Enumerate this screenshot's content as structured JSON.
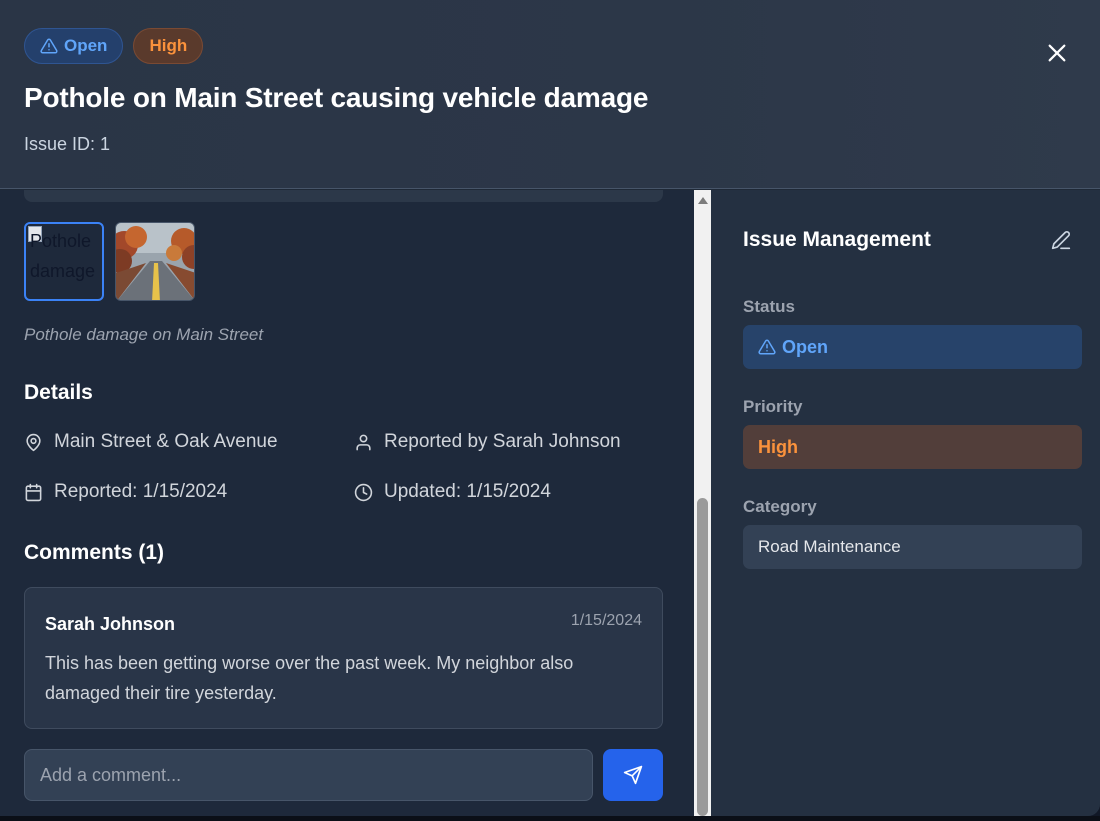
{
  "header": {
    "status_badge": "Open",
    "priority_badge": "High",
    "title": "Pothole on Main Street causing vehicle damage",
    "issue_id": "Issue ID: 1"
  },
  "media": {
    "broken_image_alt": "Pothole damage",
    "caption": "Pothole damage on Main Street"
  },
  "details": {
    "heading": "Details",
    "location": "Main Street & Oak Avenue",
    "reporter": "Reported by Sarah Johnson",
    "reported": "Reported: 1/15/2024",
    "updated": "Updated: 1/15/2024"
  },
  "comments": {
    "heading": "Comments (1)",
    "items": [
      {
        "author": "Sarah Johnson",
        "date": "1/15/2024",
        "text": "This has been getting worse over the past week. My neighbor also damaged their tire yesterday."
      }
    ],
    "input_placeholder": "Add a comment..."
  },
  "management": {
    "title": "Issue Management",
    "status_label": "Status",
    "status_value": "Open",
    "priority_label": "Priority",
    "priority_value": "High",
    "category_label": "Category",
    "category_value": "Road Maintenance"
  },
  "icons": {
    "status": "alert-triangle-icon",
    "close": "close-icon",
    "location": "map-pin-icon",
    "reporter": "user-icon",
    "reported": "calendar-icon",
    "updated": "clock-icon",
    "send": "send-icon",
    "edit": "edit-icon"
  },
  "colors": {
    "status_blue": "#60a5fa",
    "priority_orange": "#fb923c",
    "send_button": "#2563eb"
  }
}
